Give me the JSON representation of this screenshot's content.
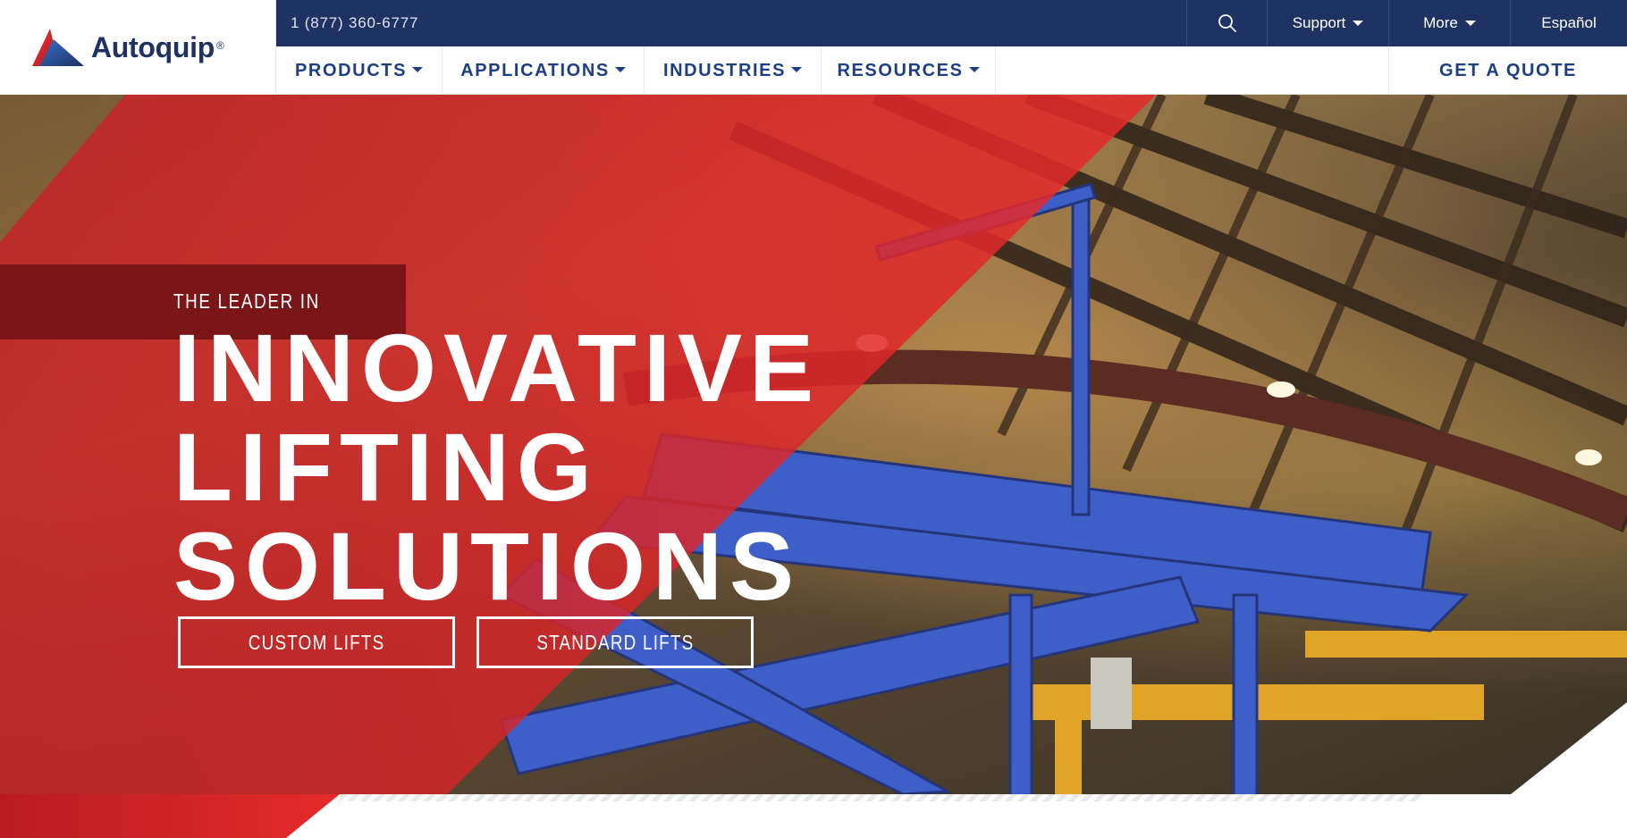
{
  "brand": {
    "name": "Autoquip",
    "registered": "®"
  },
  "topbar": {
    "phone": "1 (877) 360-6777",
    "support_label": "Support",
    "more_label": "More",
    "language_label": "Español"
  },
  "nav": {
    "items": [
      {
        "label": "PRODUCTS"
      },
      {
        "label": "APPLICATIONS"
      },
      {
        "label": "INDUSTRIES"
      },
      {
        "label": "RESOURCES"
      }
    ],
    "cta_label": "GET A QUOTE"
  },
  "hero": {
    "eyebrow": "THE LEADER IN",
    "headline_lines": [
      "INNOVATIVE",
      "LIFTING",
      "SOLUTIONS"
    ],
    "buttons": [
      {
        "label": "CUSTOM LIFTS"
      },
      {
        "label": "STANDARD LIFTS"
      }
    ]
  },
  "colors": {
    "navy": "#1e3264",
    "nav_text": "#1e3f84",
    "brand_red": "#e0292b",
    "dark_red": "#7a1518",
    "lift_blue": "#3f5fc8"
  },
  "icons": [
    "search-icon",
    "logo-mark-icon",
    "chevron-down-icon"
  ]
}
